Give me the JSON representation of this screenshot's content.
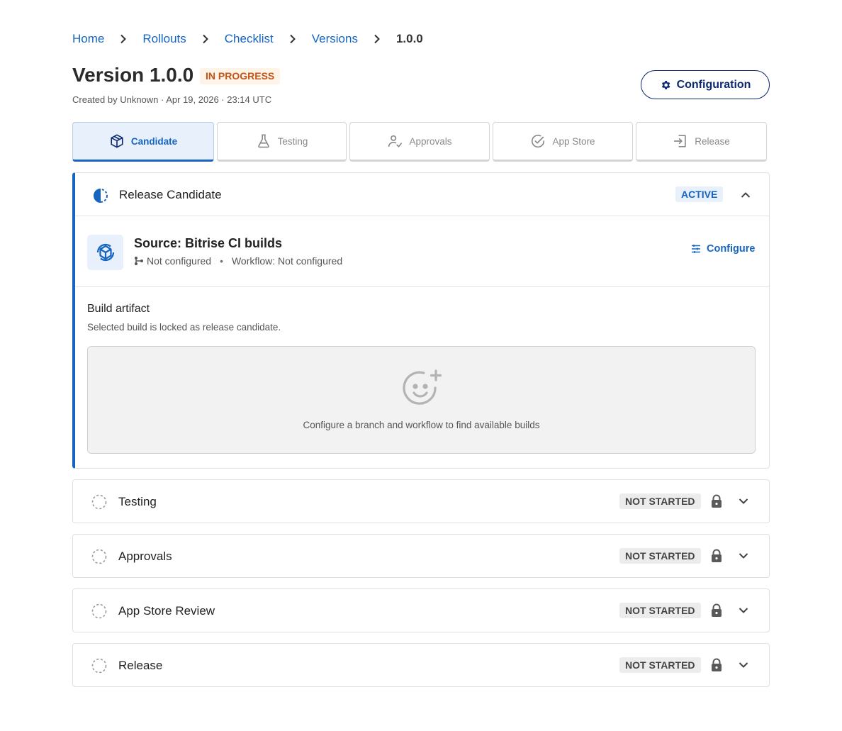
{
  "breadcrumb": {
    "items": [
      "Home",
      "Rollouts",
      "Checklist",
      "Versions"
    ],
    "current": "1.0.0"
  },
  "header": {
    "title": "Version 1.0.0",
    "status": "IN PROGRESS",
    "meta": "Created by Unknown · Apr 19, 2026 · 23:14 UTC",
    "config_button": "Configuration"
  },
  "tabs": [
    {
      "label": "Candidate",
      "icon": "package-icon",
      "active": true
    },
    {
      "label": "Testing",
      "icon": "flask-icon",
      "active": false
    },
    {
      "label": "Approvals",
      "icon": "user-check-icon",
      "active": false
    },
    {
      "label": "App Store",
      "icon": "check-circle-icon",
      "active": false
    },
    {
      "label": "Release",
      "icon": "login-icon",
      "active": false
    }
  ],
  "release_candidate": {
    "title": "Release Candidate",
    "badge": "ACTIVE",
    "source": {
      "title": "Source: Bitrise CI builds",
      "branch": "Not configured",
      "workflow": "Workflow: Not configured",
      "configure_label": "Configure"
    },
    "artifact": {
      "title": "Build artifact",
      "subtitle": "Selected build is locked as release candidate.",
      "empty_text": "Configure a branch and workflow to find available builds"
    }
  },
  "sections": [
    {
      "title": "Testing",
      "badge": "NOT STARTED"
    },
    {
      "title": "Approvals",
      "badge": "NOT STARTED"
    },
    {
      "title": "App Store Review",
      "badge": "NOT STARTED"
    },
    {
      "title": "Release",
      "badge": "NOT STARTED"
    }
  ],
  "colors": {
    "accent": "#1565c0",
    "navy": "#0d2a6e",
    "in_progress": "#c2541a",
    "in_progress_bg": "#fdf3e7"
  }
}
